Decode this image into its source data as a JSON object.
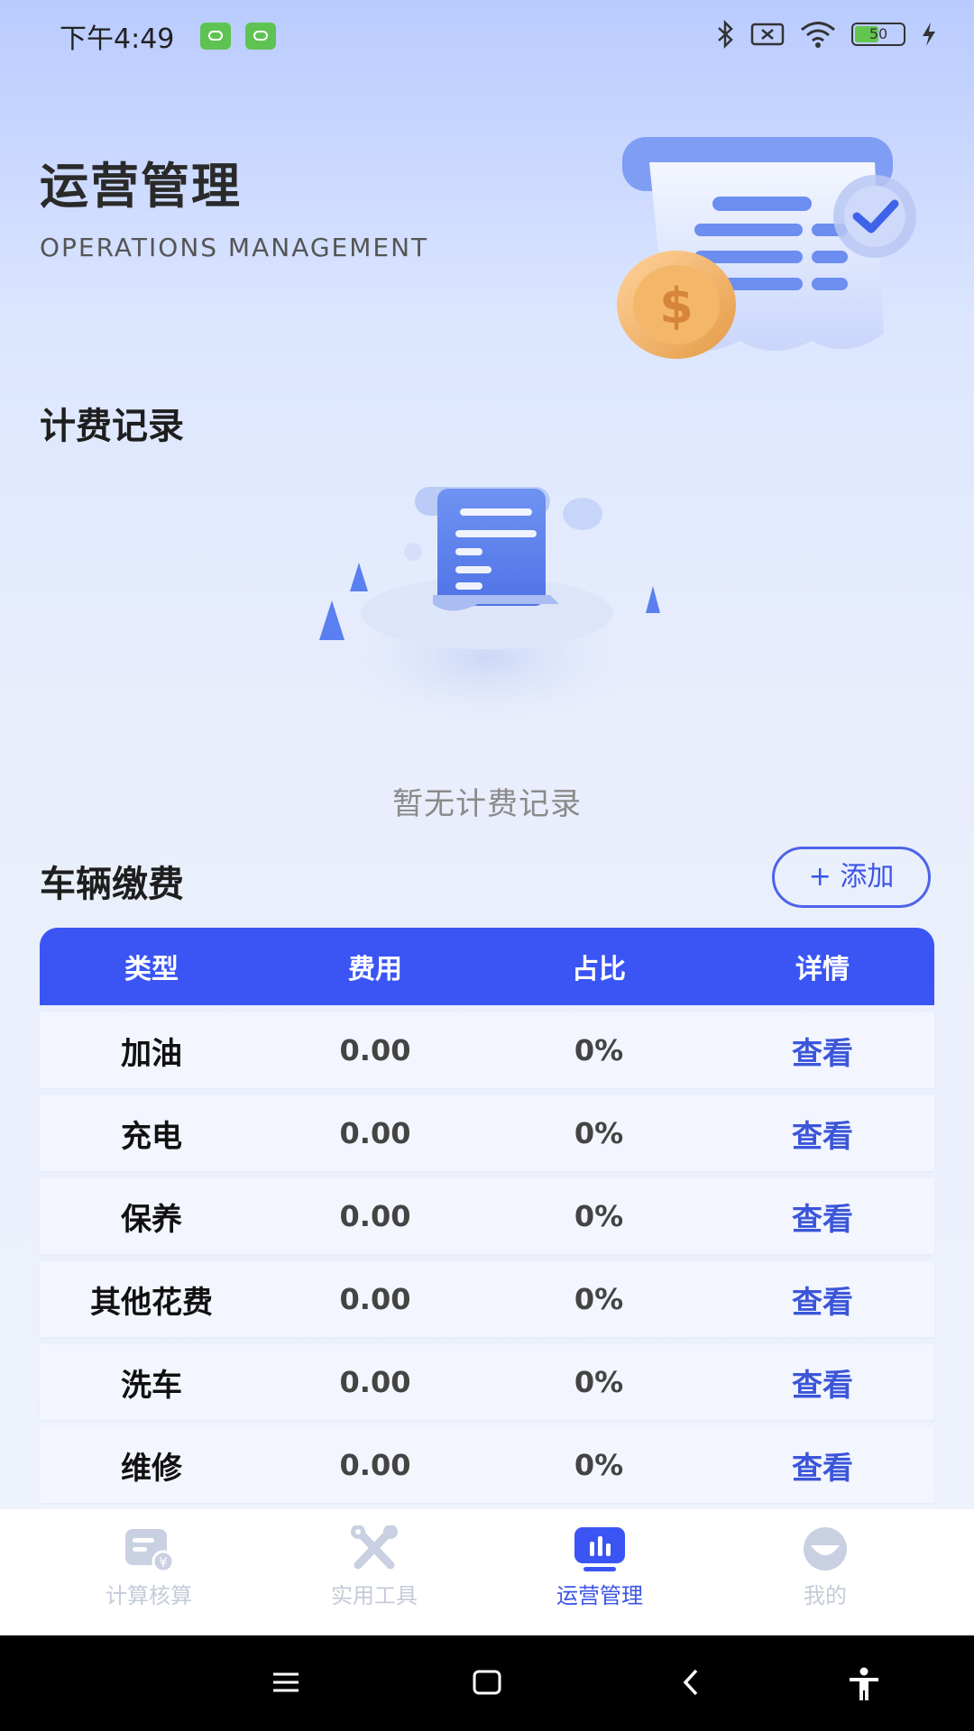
{
  "status_bar": {
    "time": "下午4:49",
    "battery_level": "50",
    "icons": [
      "app-badge-icon",
      "app-badge-icon",
      "bluetooth-icon",
      "sim-off-icon",
      "wifi-icon",
      "battery-icon",
      "charging-icon"
    ]
  },
  "header": {
    "title": "运营管理",
    "subtitle": "OPERATIONS MANAGEMENT",
    "illustration": "receipt-coin-check-illustration"
  },
  "billing_records": {
    "title": "计费记录",
    "empty_text": "暂无计费记录",
    "illustration": "empty-receipt-illustration"
  },
  "vehicle_fees": {
    "title": "车辆缴费",
    "add_button": "+ 添加",
    "columns": [
      "类型",
      "费用",
      "占比",
      "详情"
    ],
    "rows": [
      {
        "type": "加油",
        "fee": "0.00",
        "ratio": "0%",
        "detail": "查看"
      },
      {
        "type": "充电",
        "fee": "0.00",
        "ratio": "0%",
        "detail": "查看"
      },
      {
        "type": "保养",
        "fee": "0.00",
        "ratio": "0%",
        "detail": "查看"
      },
      {
        "type": "其他花费",
        "fee": "0.00",
        "ratio": "0%",
        "detail": "查看"
      },
      {
        "type": "洗车",
        "fee": "0.00",
        "ratio": "0%",
        "detail": "查看"
      },
      {
        "type": "维修",
        "fee": "0.00",
        "ratio": "0%",
        "detail": "查看"
      }
    ]
  },
  "bottom_nav": {
    "items": [
      {
        "label": "计算核算",
        "icon": "calculator-receipt-icon",
        "active": false
      },
      {
        "label": "实用工具",
        "icon": "tools-icon",
        "active": false
      },
      {
        "label": "运营管理",
        "icon": "bar-chart-icon",
        "active": true
      },
      {
        "label": "我的",
        "icon": "profile-icon",
        "active": false
      }
    ]
  },
  "colors": {
    "accent": "#3a55f4",
    "link": "#3c56d9",
    "row_background": "#f3f6ff"
  }
}
